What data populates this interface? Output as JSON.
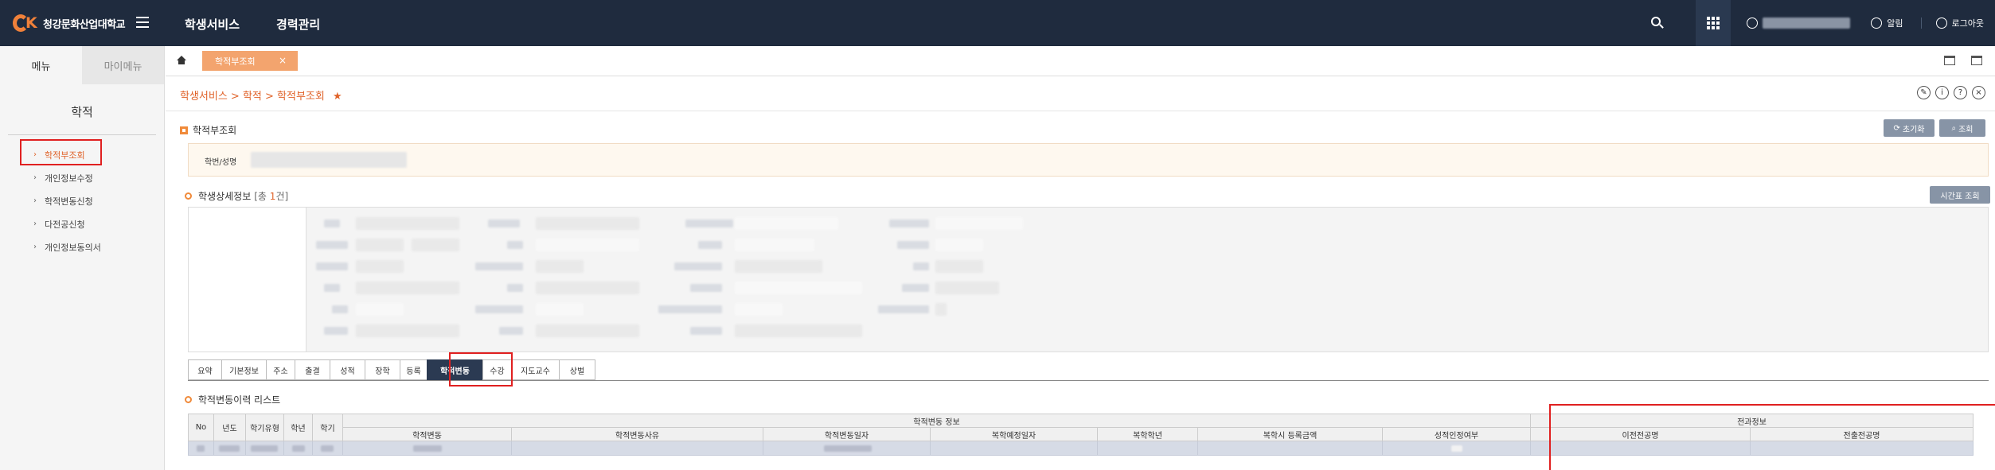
{
  "topbar": {
    "logo_text": "청강문화산업대학교",
    "nav": [
      "학생서비스",
      "경력관리"
    ],
    "alarm": "알림",
    "logout": "로그아웃"
  },
  "sidebar": {
    "tabs": [
      "메뉴",
      "마이메뉴"
    ],
    "title": "학적",
    "items": [
      {
        "label": "학적부조회",
        "active": true
      },
      {
        "label": "개인정보수정",
        "active": false
      },
      {
        "label": "학적변동신청",
        "active": false
      },
      {
        "label": "다전공신청",
        "active": false
      },
      {
        "label": "개인정보동의서",
        "active": false
      }
    ]
  },
  "tabbar": {
    "page_tab": "학적부조회",
    "close": "×"
  },
  "breadcrumb": {
    "text": "학생서비스 > 학적 > 학적부조회",
    "star": "★"
  },
  "section": {
    "title": "학적부조회",
    "reset_button": "초기화",
    "search_button": "조회",
    "search_label": "학번/성명",
    "detail_title": "학생상세정보",
    "count_prefix": "[총 ",
    "count_value": "1",
    "count_suffix": "건]",
    "timetable_button": "시간표 조회",
    "history_title": "학적변동이력 리스트"
  },
  "sub_tabs": [
    "요약",
    "기본정보",
    "주소",
    "출결",
    "성적",
    "장학",
    "등록",
    "학적변동",
    "수강",
    "지도교수",
    "상벌"
  ],
  "active_sub_tab": "학적변동",
  "history_table": {
    "left_headers": [
      "No",
      "년도",
      "학기유형",
      "학년",
      "학기"
    ],
    "group_1": "학적변동 정보",
    "group_2": "전과정보",
    "sub_headers_1": [
      "학적변동",
      "학적변동사유",
      "학적변동일자",
      "복학예정일자",
      "복학학년",
      "복학시 등록금액",
      "성적인정여부"
    ],
    "sub_headers_2": [
      "이전전공명",
      "전출전공명"
    ]
  },
  "colors": {
    "topbar": "#1f2b3e",
    "accent": "#e0632a",
    "active_tab": "#2b3a52",
    "highlight_box": "#e02020"
  }
}
